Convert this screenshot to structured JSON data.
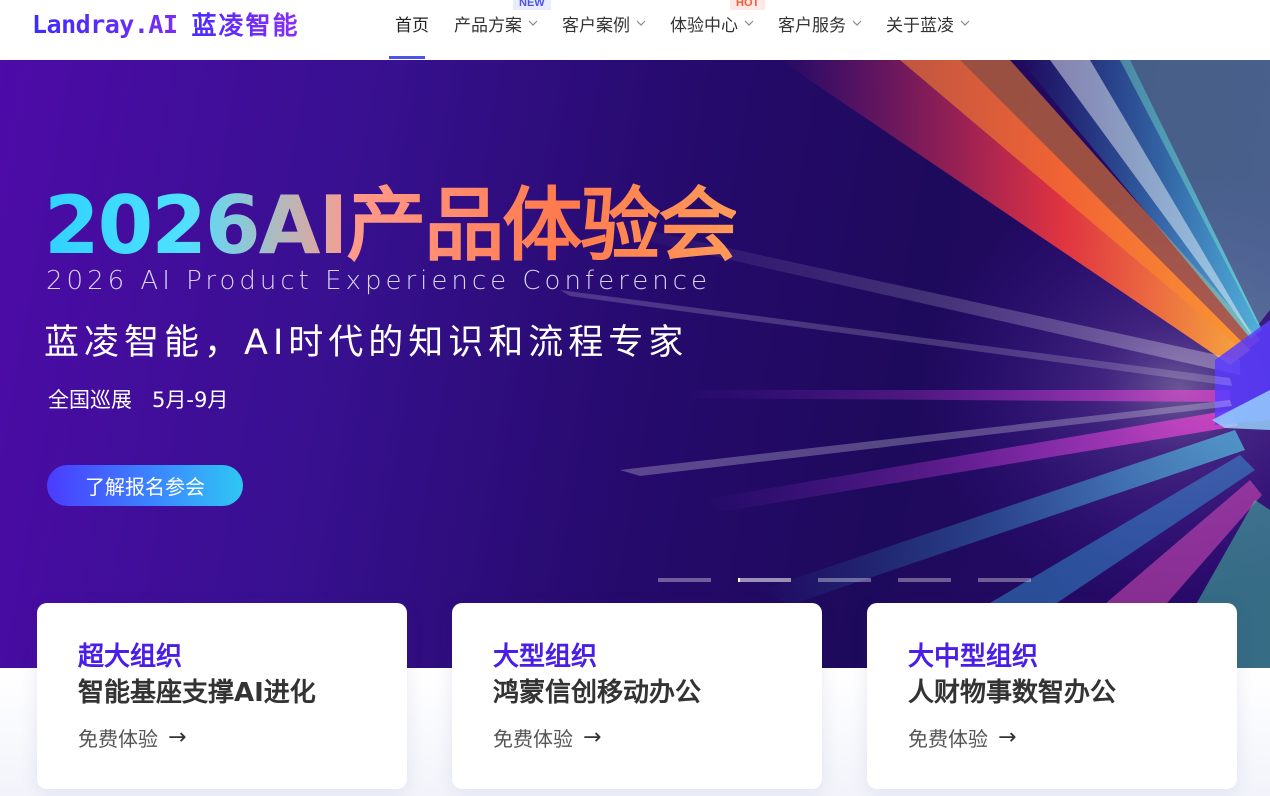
{
  "header": {
    "logo_en": "Landray.AI",
    "logo_cn": "蓝凌智能",
    "nav": [
      {
        "label": "首页",
        "active": true
      },
      {
        "label": "产品方案",
        "badge": "NEW"
      },
      {
        "label": "客户案例"
      },
      {
        "label": "体验中心",
        "badge": "HOT"
      },
      {
        "label": "客户服务"
      },
      {
        "label": "关于蓝凌"
      }
    ],
    "chevron": "⌄"
  },
  "hero": {
    "title": "2026AI产品体验会",
    "subtitle_en": "2026 AI Product Experience Conference",
    "slogan": "蓝凌智能，AI时代的知识和流程专家",
    "tour": "全国巡展   5月-9月",
    "cta": "了解报名参会",
    "carousel": {
      "count": 5,
      "active_index": 1
    }
  },
  "cards": [
    {
      "category": "超大组织",
      "title": "智能基座支撑AI进化",
      "link": "免费体验",
      "arrow": "→"
    },
    {
      "category": "大型组织",
      "title": "鸿蒙信创移动办公",
      "link": "免费体验",
      "arrow": "→"
    },
    {
      "category": "大中型组织",
      "title": "人财物事数智办公",
      "link": "免费体验",
      "arrow": "→"
    }
  ],
  "colors": {
    "accent": "#4a55e6",
    "card_category": "#4a1ee8",
    "hero_bg": "#2a0a6a"
  }
}
